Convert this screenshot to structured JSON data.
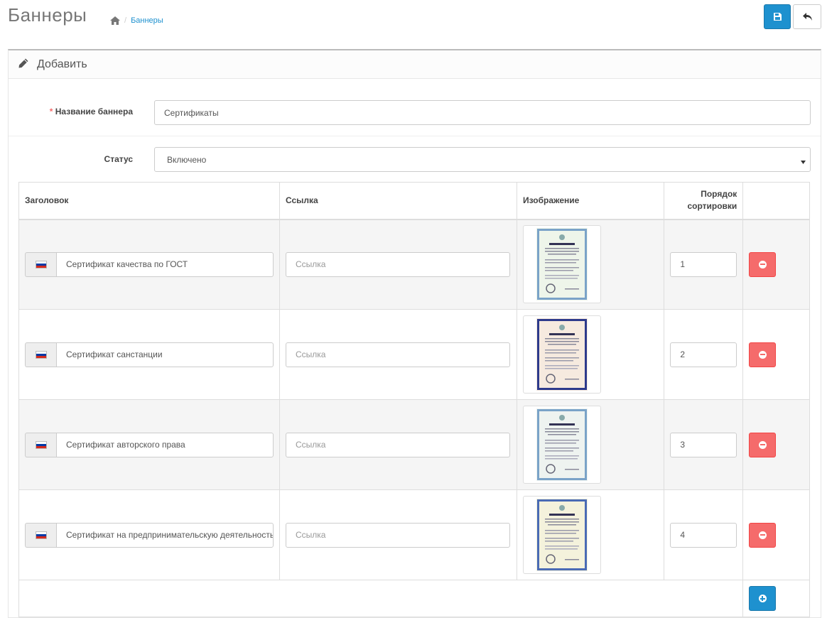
{
  "header": {
    "title": "Баннеры",
    "breadcrumb": {
      "home_icon": "home-icon",
      "separator": "/",
      "current": "Баннеры"
    },
    "save_button_icon": "save-icon",
    "back_button_icon": "reply-icon",
    "colors": {
      "primary": "#1e91cf",
      "danger": "#f56b6b"
    }
  },
  "panel": {
    "title_icon": "pencil-icon",
    "title": "Добавить"
  },
  "form": {
    "name_label_required": "*",
    "name_label": "Название баннера",
    "name_value": "Сертификаты",
    "status_label": "Статус",
    "status_value": "Включено"
  },
  "table": {
    "headers": {
      "title": "Заголовок",
      "link": "Ссылка",
      "image": "Изображение",
      "sort_line1": "Порядок",
      "sort_line2": "сортировки"
    },
    "link_placeholder": "Ссылка",
    "rows": [
      {
        "title": "Сертификат качества по ГОСТ",
        "sort": "1",
        "flag": "ru-flag-icon",
        "image": "certificate-image-1"
      },
      {
        "title": "Сертификат санстанции",
        "sort": "2",
        "flag": "ru-flag-icon",
        "image": "certificate-image-2"
      },
      {
        "title": "Сертификат авторского права",
        "sort": "3",
        "flag": "ru-flag-icon",
        "image": "certificate-image-3"
      },
      {
        "title": "Сертификат на предпринимательскую деятельность",
        "sort": "4",
        "flag": "ru-flag-icon",
        "image": "certificate-image-4"
      }
    ],
    "add_button_icon": "plus-circle-icon",
    "remove_button_icon": "minus-circle-icon"
  }
}
